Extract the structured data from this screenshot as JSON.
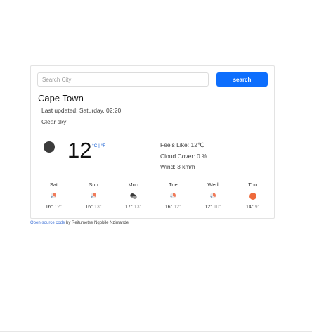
{
  "search": {
    "placeholder": "Search City",
    "value": "",
    "button_label": "search"
  },
  "current": {
    "city": "Cape Town",
    "last_updated": "Last updated: Saturday, 02:20",
    "condition": "Clear sky",
    "icon": "night-clear-icon",
    "temperature": "12",
    "unit_celsius": "°C",
    "unit_separator": "|",
    "unit_fahrenheit": "°F",
    "feels_like": "Feels Like: 12℃",
    "cloud_cover": "Cloud Cover: 0 %",
    "wind": "Wind: 3 km/h"
  },
  "forecast": [
    {
      "day": "Sat",
      "icon": "rain-icon",
      "high": "16°",
      "low": "12°"
    },
    {
      "day": "Sun",
      "icon": "rain-icon",
      "high": "16°",
      "low": "13°"
    },
    {
      "day": "Mon",
      "icon": "cloud-icon",
      "high": "17°",
      "low": "13°"
    },
    {
      "day": "Tue",
      "icon": "rain-icon",
      "high": "16°",
      "low": "12°"
    },
    {
      "day": "Wed",
      "icon": "rain-icon",
      "high": "12°",
      "low": "10°"
    },
    {
      "day": "Thu",
      "icon": "sun-icon",
      "high": "14°",
      "low": "9°"
    }
  ],
  "footer": {
    "link_text": "Open-source code",
    "credit": " by Reitumetse Nqobile Nzimande"
  },
  "colors": {
    "accent": "#0d6efd",
    "link": "#3b6fd6",
    "sun": "#ee6a3c",
    "night_icon": "#3c3c3c"
  }
}
